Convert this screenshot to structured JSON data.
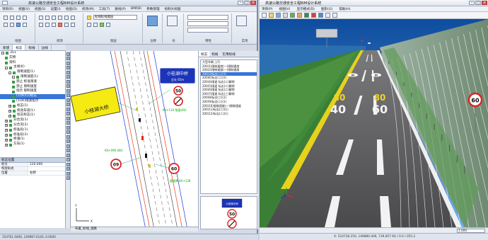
{
  "cad": {
    "menu": [
      "项目(R)",
      "视图(V)",
      "视图(S)",
      "设置(I)",
      "绘图(D)",
      "修改(M)",
      "工具(T)",
      "路线(P)",
      "BIM(B)",
      "参数管理",
      "绘制大标图"
    ],
    "ribbon_groups": [
      "绘图",
      "修改",
      "图层",
      "注释",
      "块",
      "特性",
      "实用"
    ],
    "layer_combo": "标线标线图层",
    "tabs": [
      "新建",
      "标志",
      "标线",
      "边线"
    ],
    "active_tab": "标志",
    "tree": [
      {
        "label": "351",
        "indent": 0,
        "expander": "-"
      },
      {
        "label": "实物",
        "indent": 1
      },
      {
        "label": "资料",
        "indent": 1
      },
      {
        "label": "主线(K)",
        "indent": 1,
        "expander": "-"
      },
      {
        "label": "限制速度(1)",
        "indent": 2,
        "expander": "-"
      },
      {
        "label": "限制速度(1)",
        "indent": 3,
        "expander": "-"
      },
      {
        "label": "禁止 标准限速",
        "indent": 3
      },
      {
        "label": "禁止 限制速度",
        "indent": 3
      },
      {
        "label": "指示 限制速度",
        "indent": 3
      },
      {
        "label": "(1)(K)(1)标志",
        "indent": 3,
        "selected": true
      },
      {
        "label": "(1)(K)限速指示",
        "indent": 3
      },
      {
        "label": "标志(1)",
        "indent": 2,
        "expander": "+"
      },
      {
        "label": "机动车道(1)",
        "indent": 2,
        "expander": "+"
      },
      {
        "label": "标志标志(1)",
        "indent": 2,
        "expander": "+"
      },
      {
        "label": "分合流(1)",
        "indent": 1,
        "expander": "+"
      },
      {
        "label": "分合流(2)",
        "indent": 1,
        "expander": "+"
      },
      {
        "label": "标准段(1)",
        "indent": 1,
        "expander": "+"
      },
      {
        "label": "标准段(2)",
        "indent": 1,
        "expander": "+"
      },
      {
        "label": "桥涵(1)",
        "indent": 1,
        "expander": "+"
      },
      {
        "label": "方向(1)",
        "indent": 1,
        "expander": "+"
      }
    ],
    "props": {
      "header": "标志位置",
      "rows": [
        [
          "桩号",
          "120.000"
        ],
        [
          "构架形式",
          ""
        ],
        [
          "位置",
          "右侧"
        ]
      ]
    },
    "canvas_tab": "布置_标线_道路",
    "canvas_labels": {
      "bridge_sign": "小桂湖大桥",
      "blue_sign_line1": "小桂湖中桥",
      "blue_sign_line2": "全长 65m",
      "green_note_1": "K0+110\n限速(60)",
      "green_note_2": "K0+090\n(80)",
      "green_note_3": "限速牌\nK0+128",
      "speed_60": "60",
      "speed_50": "50",
      "speed_09": "09"
    },
    "right_tabs": [
      "标志",
      "标线",
      "实用标线"
    ],
    "list_rows": [
      "大型车辆 上行",
      "200(1)限制速度(一)限制速度",
      "200(2)限制速度(一)限制速度",
      "200(3)标志(二)(1)",
      "200(K)标志(二)(1)",
      "200(4)限速 标志(二)解除",
      "200(5)限速 标志(二)解除",
      "200(6)限速 标志(二)解除",
      "200(7)限速 标志(三)解除",
      "200(8)标志(二)(1)",
      "200(9)标志(二)(1)",
      "200(10)限制速度(一)限制速度",
      "200(11)标志(二)(1)",
      "200(12)标志(二)(1)"
    ],
    "preview": {
      "sign_text": "小桂湖中桥",
      "speed": "50"
    },
    "status": "154761.0400, 149987.6140, 0.0000"
  },
  "viewer": {
    "title": "高速公路交通安全工程BIM设计系统",
    "menu": [
      "项目(P)",
      "视图(V)",
      "显示模式(D)",
      "图形(G)",
      "帮助(H)"
    ],
    "road_markings": [
      "80",
      "80",
      "40",
      "60",
      "80",
      "80"
    ],
    "speed_sign": "60",
    "ratio": "1.000",
    "status": "X: 524728.250,  149880.406,  739.857   60 / 0.0 / 055.2"
  },
  "colors": {
    "sky_top": "#0e4c9e",
    "sky_bottom": "#4fa0e6",
    "asphalt": "#5c5c5e",
    "grass": "#3f8b3a",
    "cad_selection": "#3875d7"
  }
}
